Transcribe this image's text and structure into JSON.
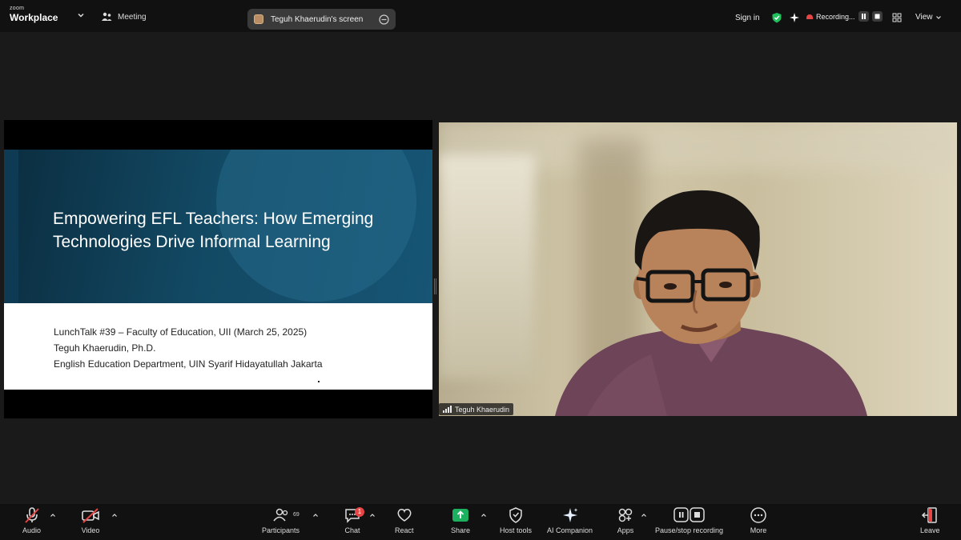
{
  "topbar": {
    "brand_small": "zoom",
    "brand_big": "Workplace",
    "meeting_label": "Meeting",
    "screen_share_label": "Teguh Khaerudin's screen",
    "signin_label": "Sign in",
    "recording_label": "Recording...",
    "view_label": "View"
  },
  "slide": {
    "title": "Empowering EFL Teachers: How Emerging Technologies Drive Informal Learning",
    "lines": [
      "LunchTalk #39 – Faculty of Education, UII (March 25, 2025)",
      "Teguh Khaerudin, Ph.D.",
      "English Education Department, UIN Syarif Hidayatullah Jakarta"
    ]
  },
  "video": {
    "participant_name": "Teguh Khaerudin"
  },
  "toolbar": {
    "audio_label": "Audio",
    "video_label": "Video",
    "participants_label": "Participants",
    "participants_count": "69",
    "chat_label": "Chat",
    "chat_badge": "1",
    "react_label": "React",
    "share_label": "Share",
    "host_tools_label": "Host tools",
    "ai_companion_label": "AI Companion",
    "apps_label": "Apps",
    "record_label": "Pause/stop recording",
    "more_label": "More",
    "leave_label": "Leave"
  },
  "colors": {
    "share_green": "#1db05e",
    "record_red": "#e64545",
    "security_green": "#1fbf5c"
  },
  "icons": [
    "chevron-down-icon",
    "meeting-icon",
    "screen-share-thumb-icon",
    "minimize-icon",
    "shield-check-icon",
    "sparkle-icon",
    "record-icon",
    "pause-icon",
    "stop-icon",
    "grid-icon",
    "mic-off-icon",
    "video-off-icon",
    "participants-icon",
    "chat-icon",
    "heart-icon",
    "share-up-icon",
    "host-tools-icon",
    "ai-companion-icon",
    "apps-icon",
    "pause-stop-record-icon",
    "more-icon",
    "leave-icon",
    "signal-icon"
  ]
}
